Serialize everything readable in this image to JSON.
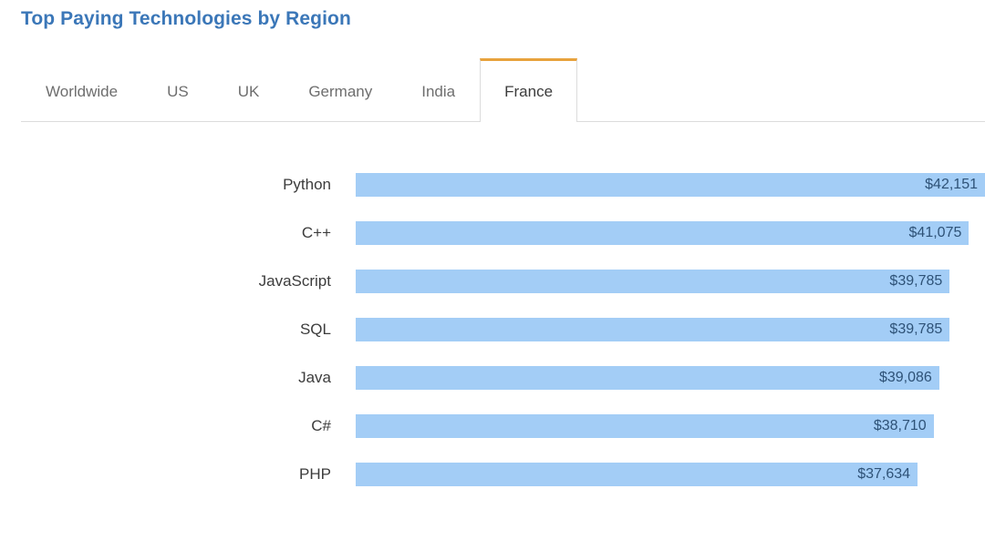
{
  "header": {
    "title": "Top Paying Technologies by Region"
  },
  "tabs": {
    "items": [
      {
        "label": "Worldwide",
        "active": false
      },
      {
        "label": "US",
        "active": false
      },
      {
        "label": "UK",
        "active": false
      },
      {
        "label": "Germany",
        "active": false
      },
      {
        "label": "India",
        "active": false
      },
      {
        "label": "France",
        "active": true
      }
    ],
    "active_index": 5,
    "active_indicator_color": "#e8a33d",
    "inactive_text_color": "#6e6e6e",
    "active_text_color": "#3c3c3c",
    "border_color": "#dcdcdc"
  },
  "colors": {
    "title": "#3b77b8",
    "bar": "#a3cdf6",
    "bar_value_text": "#2e5277",
    "category_label": "#3c3c3c",
    "background": "#ffffff"
  },
  "chart_data": {
    "type": "bar",
    "orientation": "horizontal",
    "title": "Top Paying Technologies by Region",
    "subtitle": "France",
    "xlabel": "",
    "ylabel": "",
    "grid": false,
    "legend": "none",
    "xlim": [
      0,
      42151
    ],
    "value_prefix": "$",
    "categories": [
      "Python",
      "C++",
      "JavaScript",
      "SQL",
      "Java",
      "C#",
      "PHP"
    ],
    "values": [
      42151,
      41075,
      39785,
      39785,
      39086,
      38710,
      37634
    ],
    "value_labels": [
      "$42,151",
      "$41,075",
      "$39,785",
      "$39,785",
      "$39,086",
      "$38,710",
      "$37,634"
    ],
    "bars": [
      {
        "category": "Python",
        "value": 42151,
        "label": "$42,151",
        "pct": 100.0
      },
      {
        "category": "C++",
        "value": 41075,
        "label": "$41,075",
        "pct": 97.4
      },
      {
        "category": "JavaScript",
        "value": 39785,
        "label": "$39,785",
        "pct": 94.4
      },
      {
        "category": "SQL",
        "value": 39785,
        "label": "$39,785",
        "pct": 94.4
      },
      {
        "category": "Java",
        "value": 39086,
        "label": "$39,086",
        "pct": 92.7
      },
      {
        "category": "C#",
        "value": 38710,
        "label": "$38,710",
        "pct": 91.8
      },
      {
        "category": "PHP",
        "value": 37634,
        "label": "$37,634",
        "pct": 89.2
      }
    ]
  }
}
